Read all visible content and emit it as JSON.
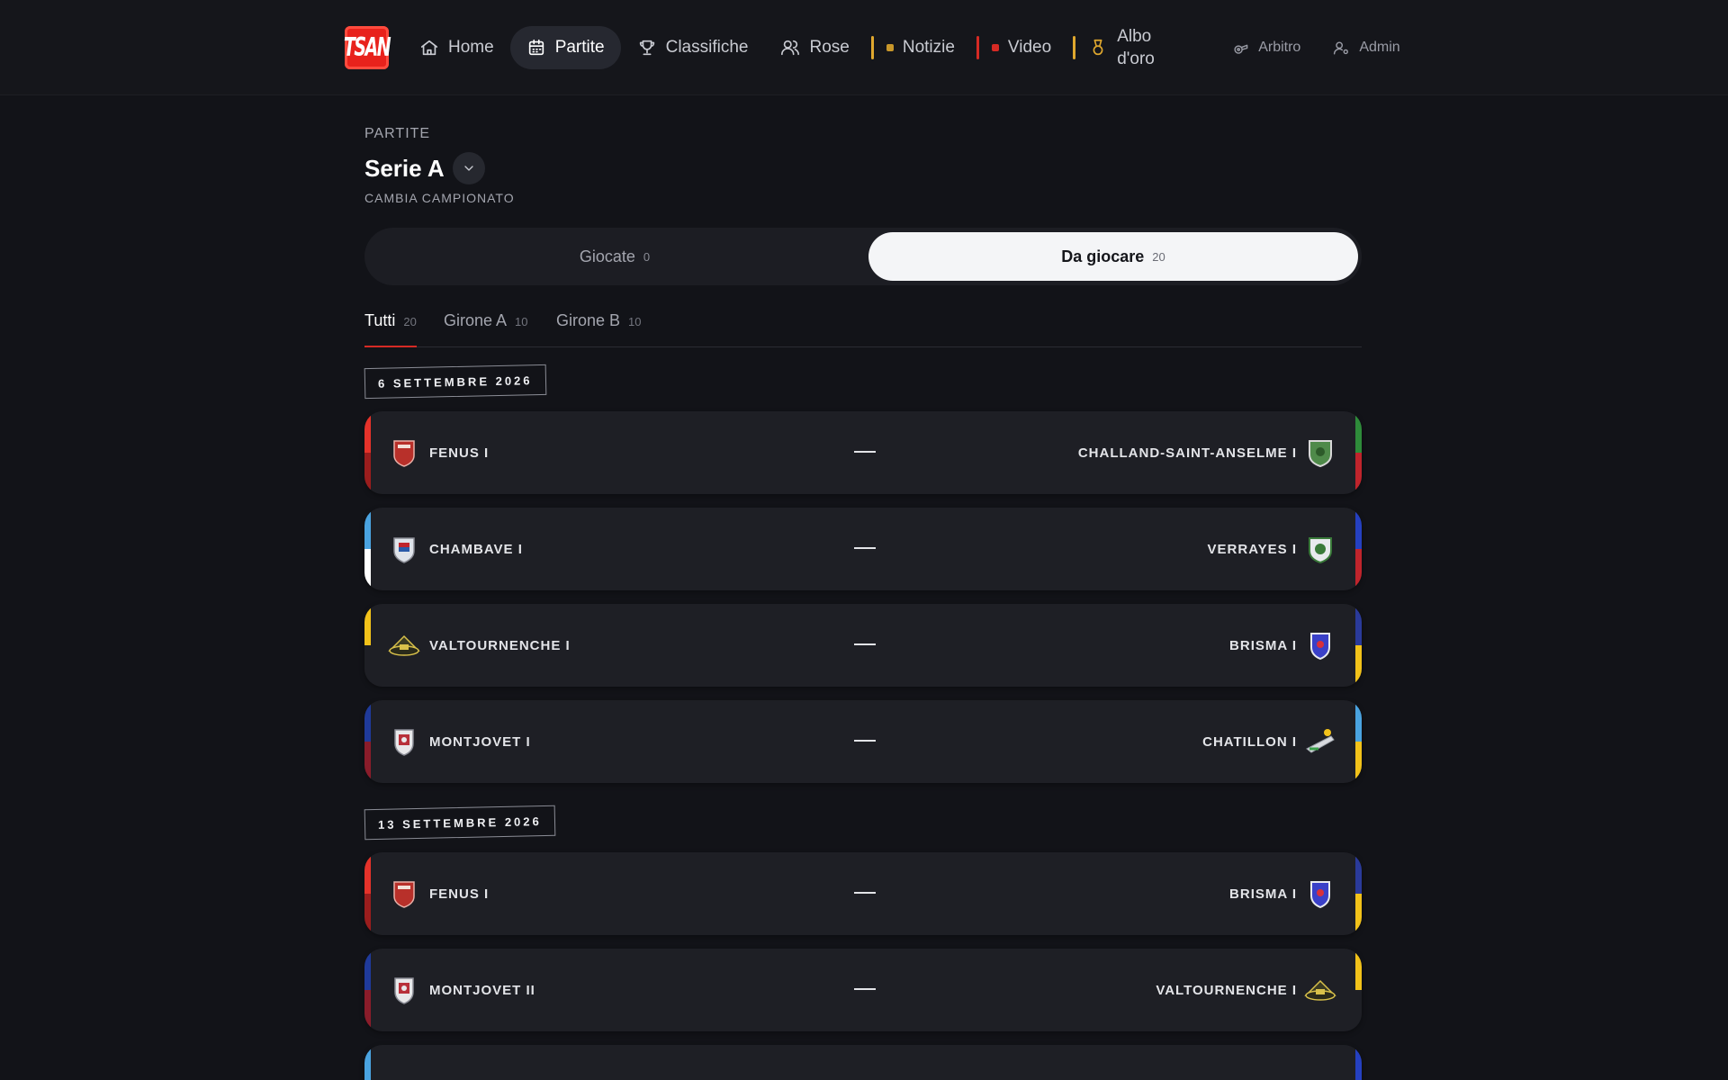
{
  "nav": {
    "logo_text": "TSAN",
    "items": [
      {
        "label": "Home",
        "icon": "home-icon"
      },
      {
        "label": "Partite",
        "icon": "calendar-icon"
      },
      {
        "label": "Classifiche",
        "icon": "trophy-icon"
      },
      {
        "label": "Rose",
        "icon": "users-icon"
      },
      {
        "label": "Notizie",
        "icon": "news-icon"
      },
      {
        "label": "Video",
        "icon": "video-icon"
      },
      {
        "label": "Albo d'oro",
        "icon": "medal-icon"
      },
      {
        "label": "Arbitro",
        "icon": "whistle-icon"
      },
      {
        "label": "Admin",
        "icon": "user-gear-icon"
      }
    ],
    "active": "Partite"
  },
  "header": {
    "kicker": "PARTITE",
    "title": "Serie A",
    "subtitle": "CAMBIA CAMPIONATO"
  },
  "segmented": {
    "played_label": "Giocate",
    "played_count": "0",
    "upcoming_label": "Da giocare",
    "upcoming_count": "20",
    "selected": "Da giocare"
  },
  "filters": [
    {
      "label": "Tutti",
      "count": "20"
    },
    {
      "label": "Girone A",
      "count": "10"
    },
    {
      "label": "Girone B",
      "count": "10"
    }
  ],
  "rounds": [
    {
      "date": "6 SETTEMBRE 2026",
      "matches": [
        {
          "home": "FENUS I",
          "away": "CHALLAND-SAINT-ANSELME I",
          "home_colors": [
            "#e5322a",
            "#9a1d1d"
          ],
          "away_colors": [
            "#2e8b3a",
            "#c0242c"
          ]
        },
        {
          "home": "CHAMBAVE I",
          "away": "VERRAYES I",
          "home_colors": [
            "#4aa3e0",
            "#ffffff"
          ],
          "away_colors": [
            "#2540c0",
            "#c0242c"
          ]
        },
        {
          "home": "VALTOURNENCHE I",
          "away": "BRISMA I",
          "home_colors": [
            "#f2c21a",
            "#1e1f25"
          ],
          "away_colors": [
            "#2a3a9a",
            "#f2c21a"
          ]
        },
        {
          "home": "MONTJOVET I",
          "away": "CHATILLON I",
          "home_colors": [
            "#1f3a9a",
            "#8a1c2a"
          ],
          "away_colors": [
            "#4aa3e0",
            "#f2c21a"
          ]
        }
      ]
    },
    {
      "date": "13 SETTEMBRE 2026",
      "matches": [
        {
          "home": "FENUS I",
          "away": "BRISMA I",
          "home_colors": [
            "#e5322a",
            "#9a1d1d"
          ],
          "away_colors": [
            "#2a3a9a",
            "#f2c21a"
          ]
        },
        {
          "home": "MONTJOVET II",
          "away": "VALTOURNENCHE I",
          "home_colors": [
            "#1f3a9a",
            "#8a1c2a"
          ],
          "away_colors": [
            "#f2c21a",
            "#1e1f25"
          ]
        },
        {
          "home": "",
          "away": "",
          "home_colors": [
            "#4aa3e0",
            "#4aa3e0"
          ],
          "away_colors": [
            "#2540c0",
            "#2540c0"
          ]
        }
      ]
    }
  ],
  "colors": {
    "accent": "#d62a24",
    "notizie_sep": "#e0a82e",
    "video_sep": "#d62a24",
    "albo_sep": "#e0a82e"
  }
}
